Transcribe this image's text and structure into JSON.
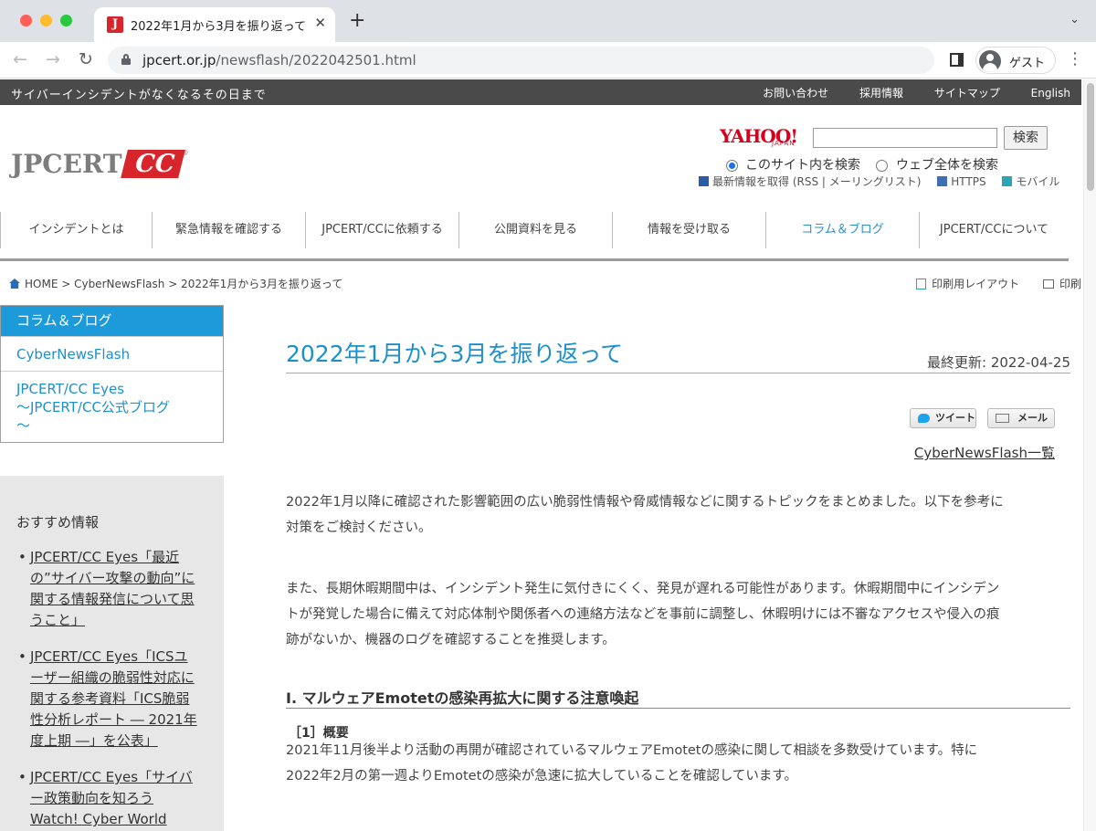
{
  "browser": {
    "tab_title": "2022年1月から3月を振り返って",
    "tab_favicon": "J",
    "url_host": "jpcert.or.jp",
    "url_path": "/newsflash/2022042501.html",
    "profile_label": "ゲスト"
  },
  "topbar": {
    "tagline": "サイバーインシデントがなくなるその日まで",
    "links": [
      "お問い合わせ",
      "採用情報",
      "サイトマップ",
      "English"
    ]
  },
  "logo": {
    "text": "JPCERT",
    "cc": "CC",
    "reg": "®"
  },
  "search": {
    "yahoo": "YAHOO!",
    "yahoo_sub": "JAPAN",
    "button": "検索",
    "option_site": "このサイト内を検索",
    "option_web": "ウェブ全体を検索"
  },
  "mini_links": {
    "rss": "最新情報を取得 (RSS | メーリングリスト)",
    "https": "HTTPS",
    "mobile": "モバイル"
  },
  "nav": [
    "インシデントとは",
    "緊急情報を確認する",
    "JPCERT/CCに依頼する",
    "公開資料を見る",
    "情報を受け取る",
    "コラム＆ブログ",
    "JPCERT/CCについて"
  ],
  "breadcrumb": "HOME > CyberNewsFlash > 2022年1月から3月を振り返って",
  "print": {
    "layout": "印刷用レイアウト",
    "print": "印刷"
  },
  "sidebar": {
    "heading": "コラム＆ブログ",
    "link1": "CyberNewsFlash",
    "link2": "JPCERT/CC Eyes",
    "link2b": "～JPCERT/CC公式ブログ",
    "link2c": "～",
    "recommend_title": "おすすめ情報",
    "recommend": [
      {
        "l1": "JPCERT/CC Eyes「最近",
        "l2": "の”サイバー攻撃の動向”に",
        "l3": "関する情報発信について思",
        "l4": "うこと」"
      },
      {
        "l1": "JPCERT/CC Eyes「ICSユ",
        "l2": "ーザー組織の脆弱性対応に",
        "l3": "関する参考資料「ICS脆弱",
        "l4": "性分析レポート ― 2021年",
        "l5": "度上期 ―」を公表」"
      },
      {
        "l1": "JPCERT/CC Eyes「サイバ",
        "l2": "ー政策動向を知ろう",
        "l3": "Watch! Cyber World"
      }
    ]
  },
  "article": {
    "title": "2022年1月から3月を振り返って",
    "updated": "最終更新: 2022-04-25",
    "tweet": "ツイート",
    "mail": "メール",
    "list_link": "CyberNewsFlash一覧",
    "p1a": "2022年1月以降に確認された影響範囲の広い脆弱性情報や脅威情報などに関するトピックをまとめました。以下を参考に",
    "p1b": "対策をご検討ください。",
    "p2a": "また、長期休暇期間中は、インシデント発生に気付きにくく、発見が遅れる可能性があります。休暇期間中にインシデン",
    "p2b": "トが発覚した場合に備えて対応体制や関係者への連絡方法などを事前に調整し、休暇明けには不審なアクセスや侵入の痕",
    "p2c": "跡がないか、機器のログを確認することを推奨します。",
    "section": "I. マルウェアEmotetの感染再拡大に関する注意喚起",
    "sub": "［1］概要",
    "p3a": "2021年11月後半より活動の再開が確認されているマルウェアEmotetの感染に関して相談を多数受けています。特に",
    "p3b": "2022年2月の第一週よりEmotetの感染が急速に拡大していることを確認しています。"
  }
}
